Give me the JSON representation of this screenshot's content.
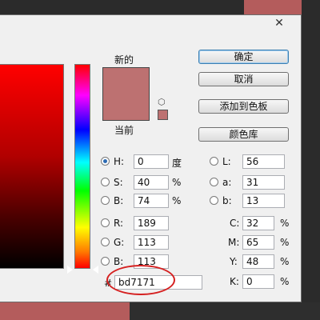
{
  "dialog": {
    "close_glyph": "✕"
  },
  "preview": {
    "new_label": "新的",
    "current_label": "当前",
    "cube_icon": "⬡"
  },
  "buttons": {
    "ok": "确定",
    "cancel": "取消",
    "add_to_swatches": "添加到色板",
    "color_libraries": "颜色库"
  },
  "hsb": {
    "h": {
      "label": "H:",
      "value": "0",
      "unit": "度"
    },
    "s": {
      "label": "S:",
      "value": "40",
      "unit": "%"
    },
    "b": {
      "label": "B:",
      "value": "74",
      "unit": "%"
    }
  },
  "lab": {
    "l": {
      "label": "L:",
      "value": "56"
    },
    "a": {
      "label": "a:",
      "value": "31"
    },
    "b": {
      "label": "b:",
      "value": "13"
    }
  },
  "rgb": {
    "r": {
      "label": "R:",
      "value": "189"
    },
    "g": {
      "label": "G:",
      "value": "113"
    },
    "b": {
      "label": "B:",
      "value": "113"
    }
  },
  "cmyk": {
    "c": {
      "label": "C:",
      "value": "32",
      "unit": "%"
    },
    "m": {
      "label": "M:",
      "value": "65",
      "unit": "%"
    },
    "y": {
      "label": "Y:",
      "value": "48",
      "unit": "%"
    },
    "k": {
      "label": "K:",
      "value": "0",
      "unit": "%"
    }
  },
  "hex": {
    "label": "#",
    "value": "bd7171"
  },
  "colors": {
    "selected": "#bd7171",
    "highlight": "#d52020"
  }
}
